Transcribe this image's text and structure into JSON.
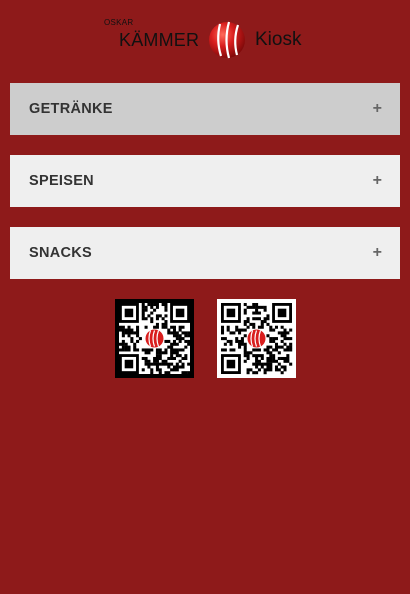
{
  "header": {
    "logo_small": "OSKAR",
    "logo_brand": "KÄMMER",
    "logo_kiosk": "Kiosk",
    "brand_color": "#8e1a1a"
  },
  "panels": [
    {
      "label": "GETRÄNKE",
      "expand_symbol": "+",
      "state": "highlighted"
    },
    {
      "label": "SPEISEN",
      "expand_symbol": "+",
      "state": "collapsed"
    },
    {
      "label": "SNACKS",
      "expand_symbol": "+",
      "state": "collapsed"
    }
  ],
  "qr_codes": [
    {
      "icon": "qr-code-icon",
      "frame_color": "#000000"
    },
    {
      "icon": "qr-code-icon",
      "frame_color": "#ffffff"
    }
  ]
}
